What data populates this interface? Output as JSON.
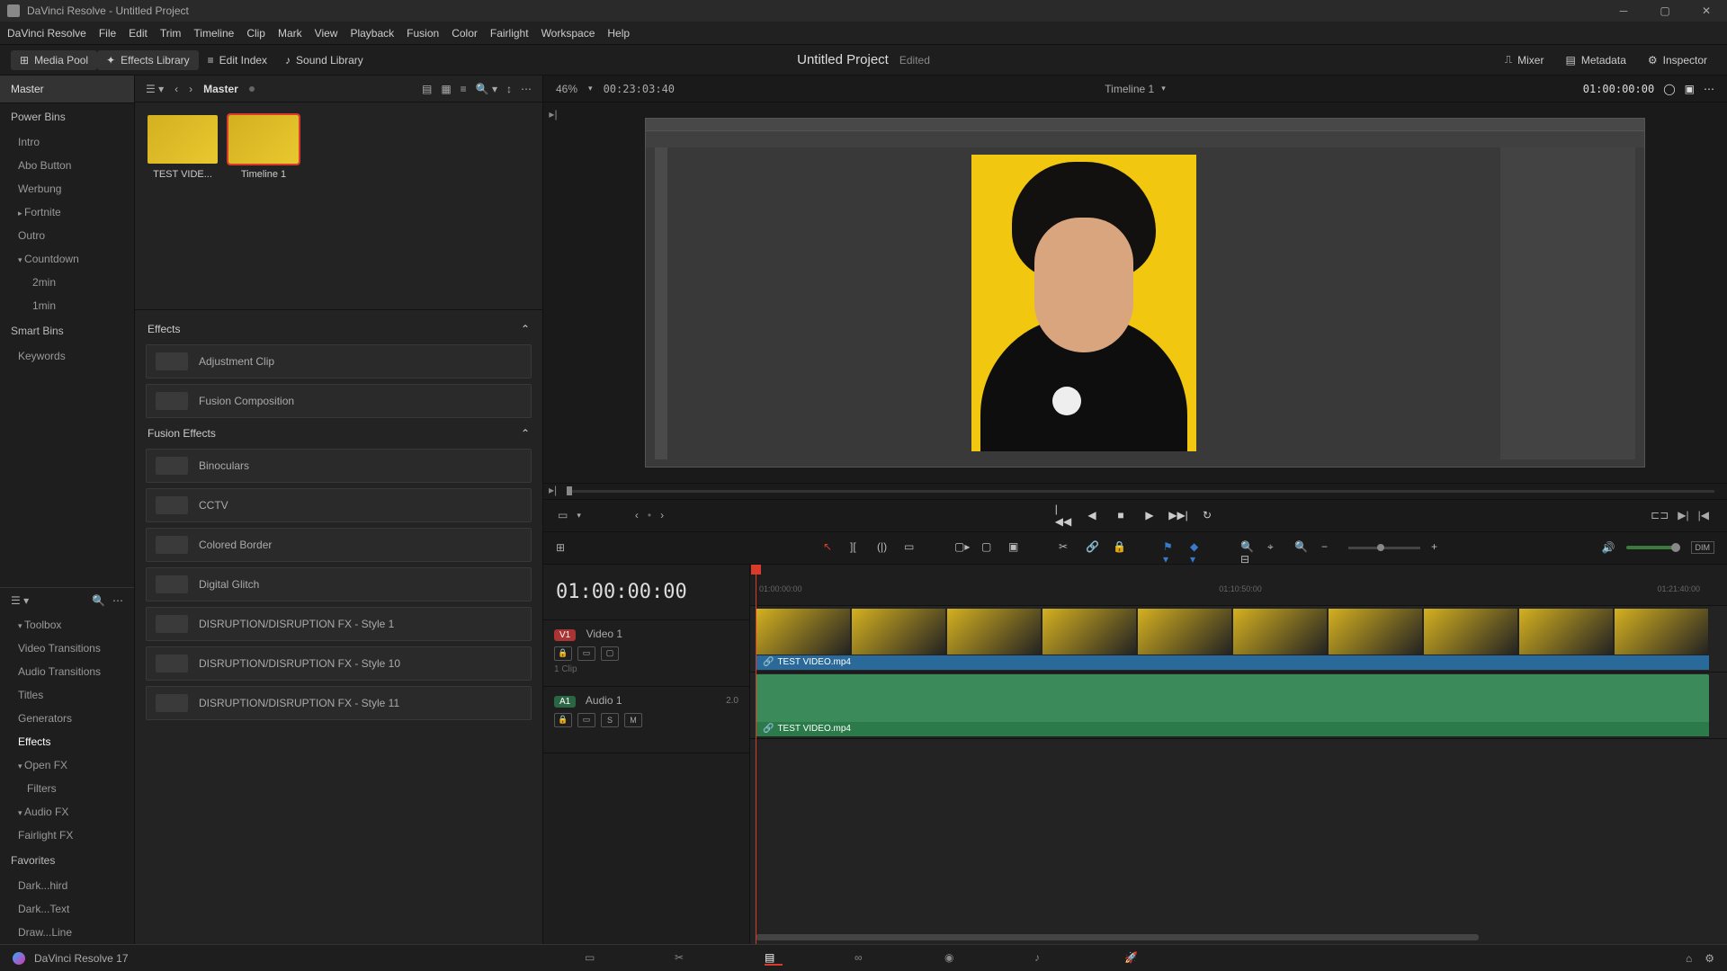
{
  "titlebar": {
    "title": "DaVinci Resolve - Untitled Project"
  },
  "menubar": [
    "DaVinci Resolve",
    "File",
    "Edit",
    "Trim",
    "Timeline",
    "Clip",
    "Mark",
    "View",
    "Playback",
    "Fusion",
    "Color",
    "Fairlight",
    "Workspace",
    "Help"
  ],
  "toolbar": {
    "media_pool": "Media Pool",
    "effects_library": "Effects Library",
    "edit_index": "Edit Index",
    "sound_library": "Sound Library",
    "project_title": "Untitled Project",
    "project_status": "Edited",
    "mixer": "Mixer",
    "metadata": "Metadata",
    "inspector": "Inspector"
  },
  "media": {
    "breadcrumb": "Master",
    "zoom_pct": "46%",
    "src_tc": "00:23:03:40",
    "thumbs": [
      {
        "label": "TEST VIDE..."
      },
      {
        "label": "Timeline 1"
      }
    ]
  },
  "bins": {
    "master": "Master",
    "power_bins": "Power Bins",
    "items": [
      "Intro",
      "Abo Button",
      "Werbung",
      "Fortnite",
      "Outro",
      "Countdown",
      "2min",
      "1min"
    ],
    "smart_bins": "Smart Bins",
    "keywords": "Keywords"
  },
  "toolbox": {
    "header": "Toolbox",
    "items": [
      "Video Transitions",
      "Audio Transitions",
      "Titles",
      "Generators",
      "Effects"
    ],
    "openfx": "Open FX",
    "filters": "Filters",
    "audiofx": "Audio FX",
    "fairlightfx": "Fairlight FX",
    "favorites": "Favorites",
    "fav_items": [
      "Dark...hird",
      "Dark...Text",
      "Draw...Line"
    ]
  },
  "effects": {
    "section1": "Effects",
    "adj": "Adjustment Clip",
    "fusion_comp": "Fusion Composition",
    "section2": "Fusion Effects",
    "fx": [
      "Binoculars",
      "CCTV",
      "Colored Border",
      "Digital Glitch",
      "DISRUPTION/DISRUPTION FX - Style 1",
      "DISRUPTION/DISRUPTION FX - Style 10",
      "DISRUPTION/DISRUPTION FX - Style 11"
    ]
  },
  "viewer": {
    "timeline_name": "Timeline 1",
    "timecode": "01:00:00:00"
  },
  "timeline": {
    "timecode": "01:00:00:00",
    "video_track": "Video 1",
    "v_badge": "V1",
    "v_count": "1 Clip",
    "audio_track": "Audio 1",
    "a_badge": "A1",
    "a_meter": "2.0",
    "clip_name": "TEST VIDEO.mp4",
    "ruler_marks": [
      "01:00:00:00",
      "01:10:50:00",
      "01:21:40:00"
    ]
  },
  "bottombar": {
    "version": "DaVinci Resolve 17"
  }
}
